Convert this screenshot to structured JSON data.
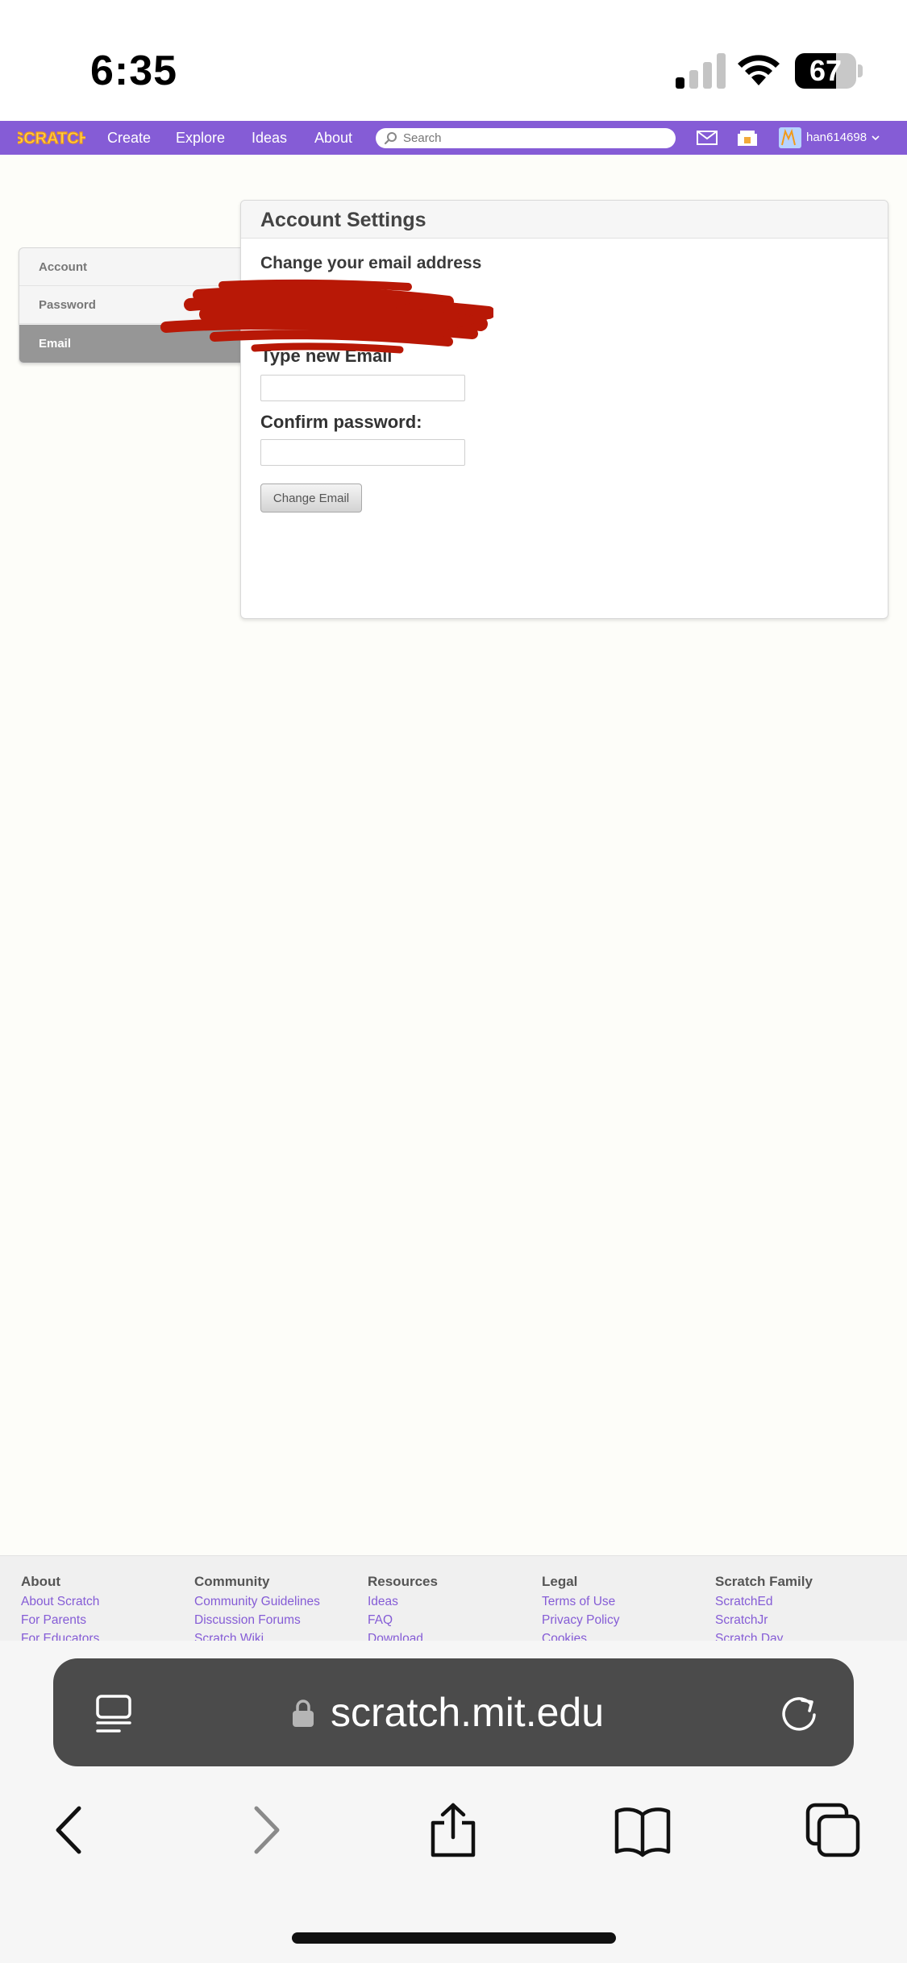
{
  "status_bar": {
    "time": "6:35",
    "battery": "67",
    "battery_fill": 0.67
  },
  "navbar": {
    "logo_text": "SCRATCH",
    "links": [
      "Create",
      "Explore",
      "Ideas",
      "About"
    ],
    "search_placeholder": "Search",
    "username": "han614698",
    "colors": {
      "brand": "#855cd6"
    }
  },
  "sidebar": {
    "items": [
      {
        "label": "Account"
      },
      {
        "label": "Password"
      },
      {
        "label": "Email"
      }
    ]
  },
  "panel": {
    "title": "Account Settings",
    "section_title": "Change your email address",
    "new_email_label": "Type new Email",
    "confirm_password_label": "Confirm password:",
    "button_label": "Change Email"
  },
  "footer": {
    "columns": [
      {
        "heading": "About",
        "links": [
          "About Scratch",
          "For Parents",
          "For Educators"
        ]
      },
      {
        "heading": "Community",
        "links": [
          "Community Guidelines",
          "Discussion Forums",
          "Scratch Wiki"
        ]
      },
      {
        "heading": "Resources",
        "links": [
          "Ideas",
          "FAQ",
          "Download"
        ]
      },
      {
        "heading": "Legal",
        "links": [
          "Terms of Use",
          "Privacy Policy",
          "Cookies"
        ]
      },
      {
        "heading": "Scratch Family",
        "links": [
          "ScratchEd",
          "ScratchJr",
          "Scratch Day"
        ]
      }
    ]
  },
  "safari": {
    "url": "scratch.mit.edu"
  }
}
